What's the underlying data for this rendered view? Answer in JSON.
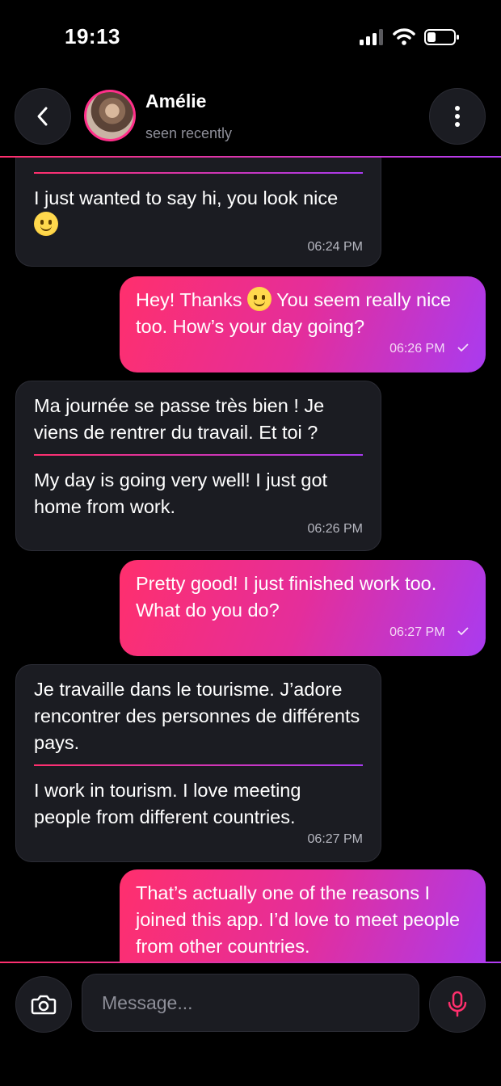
{
  "status_bar": {
    "time": "19:13"
  },
  "header": {
    "name": "Amélie",
    "status": "seen recently"
  },
  "messages": [
    {
      "dir": "in",
      "original": "",
      "translation": "I just wanted to say hi, you look nice",
      "emoji": "smiling-face",
      "time": "06:24 PM"
    },
    {
      "dir": "out",
      "text_a": "Hey! Thanks",
      "emoji": "smiling-face",
      "text_b": "You seem really nice too. How’s your day going?",
      "time": "06:26 PM",
      "read": true
    },
    {
      "dir": "in",
      "original": "Ma journée se passe très bien ! Je viens de rentrer du travail. Et toi ?",
      "translation": "My day is going very well! I just got home from work.",
      "time": "06:26 PM"
    },
    {
      "dir": "out",
      "text": "Pretty good! I just finished work too. What do you do?",
      "time": "06:27 PM",
      "read": true
    },
    {
      "dir": "in",
      "original": "Je travaille dans le tourisme. J’adore rencontrer des personnes de différents pays.",
      "translation": "I work in tourism. I love meeting people from different countries.",
      "time": "06:27 PM"
    },
    {
      "dir": "out",
      "text": "That’s actually one of the reasons I joined this app. I’d love to meet people from other countries."
    }
  ],
  "composer": {
    "placeholder": "Message..."
  },
  "colors": {
    "accent_start": "#ff2f6d",
    "accent_end": "#a93bf0",
    "bubble_in": "#1b1c22",
    "background": "#000000"
  },
  "icons": {
    "back": "chevron-left-icon",
    "menu": "more-vertical-icon",
    "camera": "camera-icon",
    "mic": "microphone-icon"
  }
}
